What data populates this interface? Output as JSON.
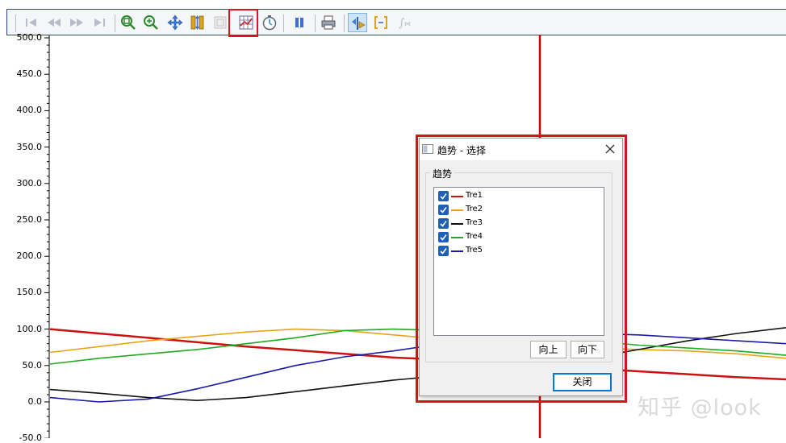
{
  "toolbar": {
    "icons": [
      "first-icon",
      "rewind-icon",
      "forward-icon",
      "last-icon",
      "zoom-fit-icon",
      "zoom-in-icon",
      "pan-icon",
      "ruler-icon",
      "zoom-box-icon",
      "trend-select-icon",
      "timer-icon",
      "pause-icon",
      "print-icon",
      "cursor-icon",
      "bracket-icon",
      "function-icon"
    ]
  },
  "plot": {
    "y_ticks": [
      "500.0",
      "450.0",
      "400.0",
      "350.0",
      "300.0",
      "250.0",
      "200.0",
      "150.0",
      "100.0",
      "50.0",
      "0.0",
      "-50.0"
    ],
    "cursor_color": "#cc0000",
    "watermark": "知乎 @look"
  },
  "chart_data": {
    "type": "line",
    "ylim": [
      -50,
      500
    ],
    "series": [
      {
        "name": "Tre1",
        "color": "#cc1111",
        "values": [
          100,
          94,
          88,
          82,
          76,
          71,
          66,
          61,
          58,
          54,
          50,
          46,
          42,
          38,
          34,
          31
        ]
      },
      {
        "name": "Tre2",
        "color": "#e8a317",
        "values": [
          68,
          76,
          84,
          90,
          96,
          100,
          98,
          92,
          86,
          80,
          76,
          74,
          72,
          70,
          66,
          60
        ]
      },
      {
        "name": "Tre3",
        "color": "#111111",
        "values": [
          17,
          12,
          6,
          2,
          6,
          14,
          22,
          30,
          36,
          42,
          50,
          60,
          72,
          84,
          94,
          102
        ]
      },
      {
        "name": "Tre4",
        "color": "#22aa22",
        "values": [
          52,
          60,
          66,
          72,
          80,
          88,
          98,
          100,
          98,
          94,
          88,
          84,
          78,
          74,
          70,
          64
        ]
      },
      {
        "name": "Tre5",
        "color": "#1a1aa8",
        "values": [
          6,
          0,
          4,
          18,
          34,
          50,
          62,
          70,
          80,
          88,
          92,
          94,
          92,
          88,
          84,
          80
        ]
      }
    ]
  },
  "dialog": {
    "title": "趋势 - 选择",
    "group_title": "趋势",
    "items": [
      {
        "label": "Tre1",
        "checked": true,
        "color": "#cc1111"
      },
      {
        "label": "Tre2",
        "checked": true,
        "color": "#e8a317"
      },
      {
        "label": "Tre3",
        "checked": true,
        "color": "#111111"
      },
      {
        "label": "Tre4",
        "checked": true,
        "color": "#22aa22"
      },
      {
        "label": "Tre5",
        "checked": true,
        "color": "#1a1aa8"
      }
    ],
    "up_label": "向上",
    "down_label": "向下",
    "close_label": "关闭"
  }
}
